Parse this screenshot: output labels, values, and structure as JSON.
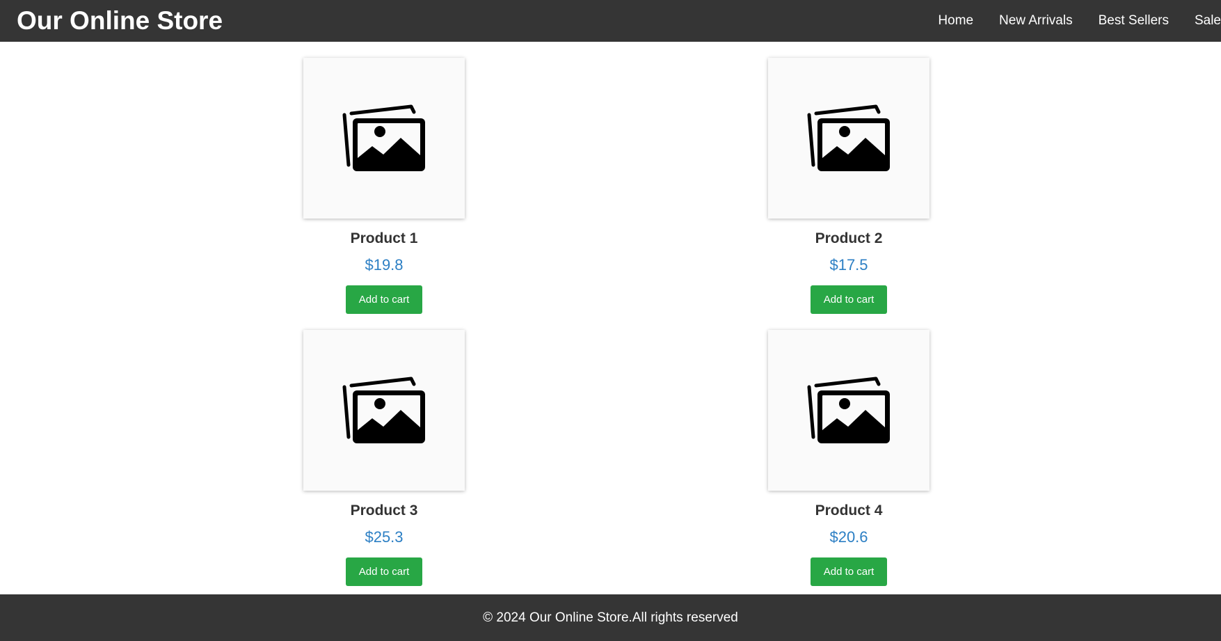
{
  "header": {
    "title": "Our Online Store",
    "nav": [
      "Home",
      "New Arrivals",
      "Best Sellers",
      "Sale"
    ]
  },
  "products": [
    {
      "name": "Product 1",
      "price": "$19.8",
      "button": "Add to cart",
      "image_icon": "image-placeholder-icon"
    },
    {
      "name": "Product 2",
      "price": "$17.5",
      "button": "Add to cart",
      "image_icon": "image-placeholder-icon"
    },
    {
      "name": "Product 3",
      "price": "$25.3",
      "button": "Add to cart",
      "image_icon": "image-placeholder-icon"
    },
    {
      "name": "Product 4",
      "price": "$20.6",
      "button": "Add to cart",
      "image_icon": "image-placeholder-icon"
    }
  ],
  "footer": {
    "text": "© 2024 Our Online Store.All rights reserved"
  },
  "colors": {
    "header_bg": "#353535",
    "price": "#2c7fc4",
    "button": "#28a745"
  }
}
